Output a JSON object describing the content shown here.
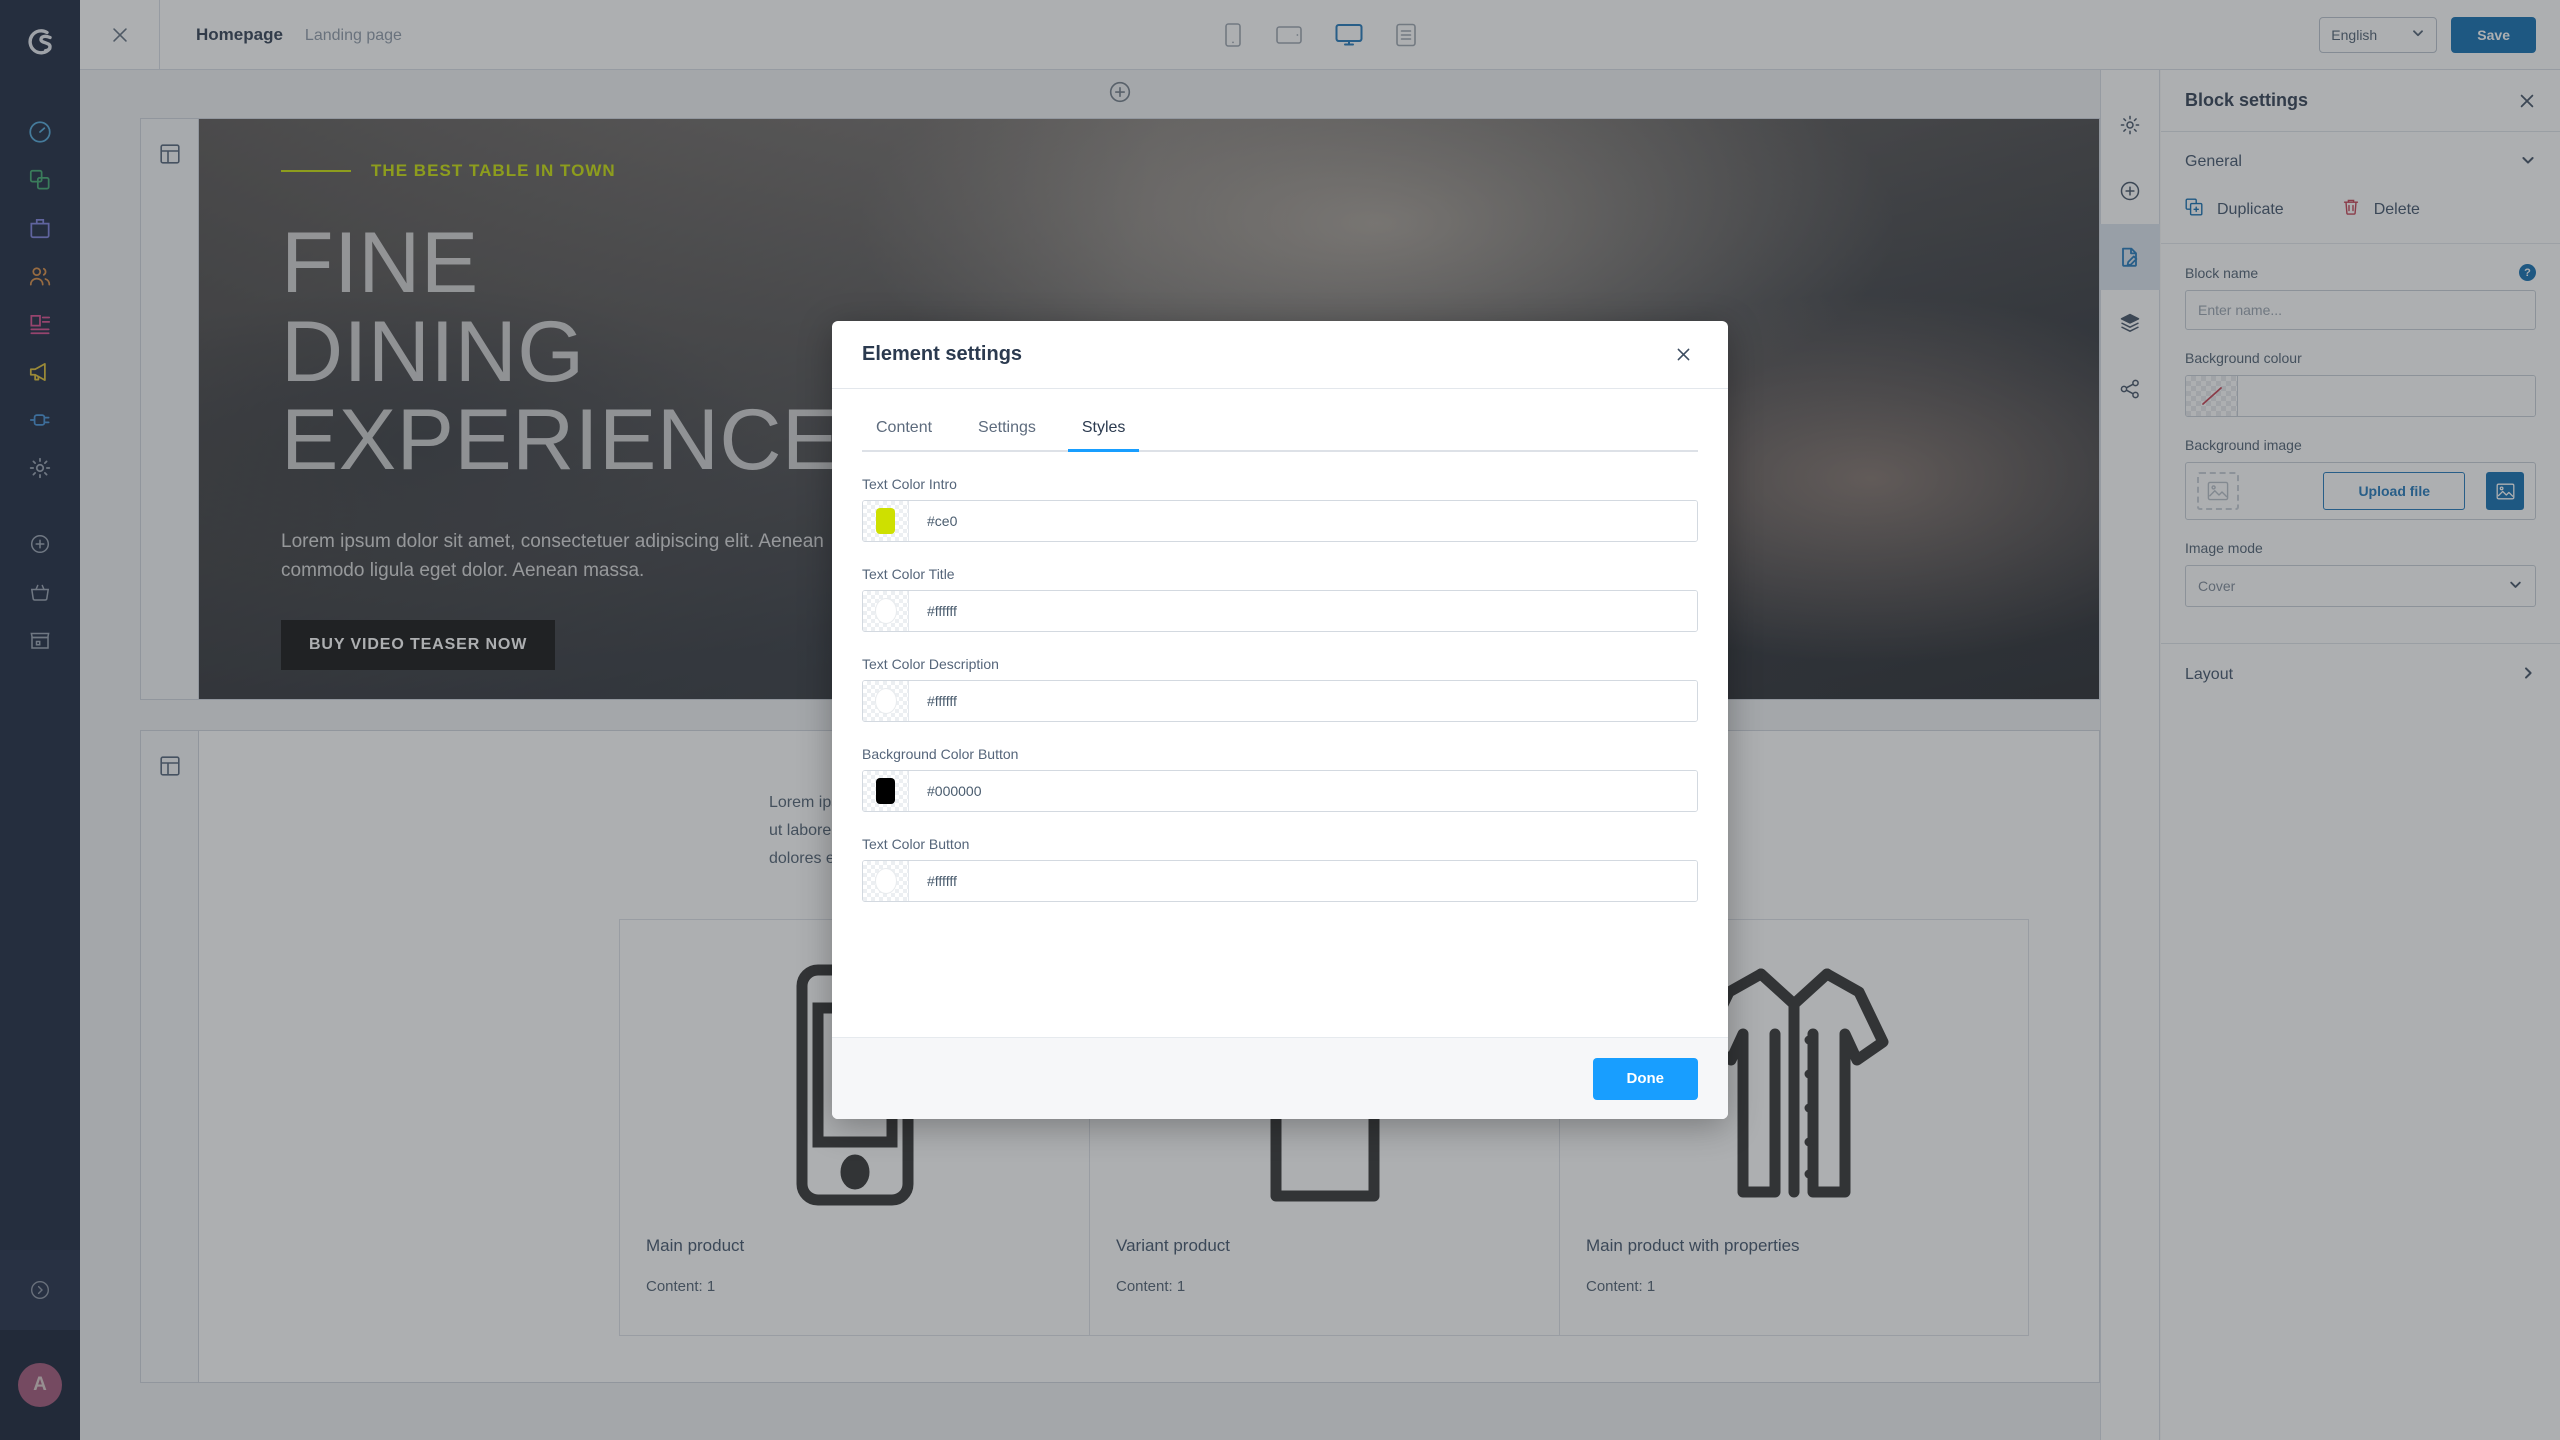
{
  "app": {
    "logo_icon": "shopware-logo-icon"
  },
  "left_nav": {
    "close_icon": "close-icon",
    "items": [
      {
        "icon": "dashboard-icon",
        "label": "Dashboard",
        "color": "#4da6d9"
      },
      {
        "icon": "catalogue-icon",
        "label": "Catalogues",
        "color": "#3aa86b"
      },
      {
        "icon": "orders-icon",
        "label": "Orders",
        "color": "#7b7ede"
      },
      {
        "icon": "customers-icon",
        "label": "Customers",
        "color": "#d98a3f"
      },
      {
        "icon": "content-icon",
        "label": "Content",
        "color": "#d9488c"
      },
      {
        "icon": "marketing-icon",
        "label": "Marketing",
        "color": "#e0c02e"
      },
      {
        "icon": "extensions-icon",
        "label": "Extensions",
        "color": "#3f90d9"
      },
      {
        "icon": "settings-gear-icon",
        "label": "Settings",
        "color": "#97a1b0"
      },
      {
        "icon": "plus-circle-icon",
        "label": "Add",
        "color": "#97a1b0"
      },
      {
        "icon": "basket-icon",
        "label": "Basket",
        "color": "#97a1b0"
      },
      {
        "icon": "store-icon",
        "label": "Store",
        "color": "#97a1b0"
      }
    ],
    "collapse_icon": "chevron-right-circle-icon",
    "avatar_initial": "A",
    "avatar_color": "#9f5175"
  },
  "header": {
    "breadcrumb_main": "Homepage",
    "breadcrumb_sub": "Landing page",
    "devices": [
      {
        "icon": "mobile-icon",
        "label": "Mobile",
        "active": false
      },
      {
        "icon": "tablet-icon",
        "label": "Tablet",
        "active": false
      },
      {
        "icon": "desktop-icon",
        "label": "Desktop",
        "active": true
      },
      {
        "icon": "list-view-icon",
        "label": "List view",
        "active": false
      }
    ],
    "language_value": "English",
    "language_chevron_icon": "chevron-down-icon",
    "save_label": "Save",
    "save_color": "#0a6aaf"
  },
  "stage": {
    "add_section_icon": "plus-circle-icon",
    "block_handle_icon": "layout-block-icon",
    "hero": {
      "eyebrow": "THE BEST TABLE IN TOWN",
      "eyebrow_color": "#c8e000",
      "title_lines": [
        "FINE",
        "DINING",
        "EXPERIENCE"
      ],
      "description": "Lorem ipsum dolor sit amet, consectetuer adipiscing elit. Aenean commodo ligula eget dolor. Aenean massa.",
      "cta_label": "BUY VIDEO TEASER NOW",
      "cta_bg": "#000000",
      "cta_text_color": "#ffffff"
    },
    "listing": {
      "text": "Lorem ipsum dolor sit amet, consetetur sadipscing elitr, sed diam nonumy eirmod tempor invidunt ut labore et dolore magna aliquyam erat, sed diam voluptua. At vero eos et accusam et justo duo dolores et ea rebum.",
      "cards": [
        {
          "art_icon": "mobile-phone-outline-icon",
          "title": "Main product",
          "meta": "Content: 1"
        },
        {
          "art_icon": "shirt-outline-icon",
          "title": "Variant product",
          "meta": "Content: 1"
        },
        {
          "art_icon": "jacket-outline-icon",
          "title": "Main product with properties",
          "meta": "Content: 1"
        }
      ]
    }
  },
  "tool_rail": {
    "items": [
      {
        "icon": "settings-gear-icon",
        "label": "Settings",
        "active": false
      },
      {
        "icon": "plus-circle-icon",
        "label": "Add block",
        "active": false
      },
      {
        "icon": "edit-document-icon",
        "label": "Edit content",
        "active": true
      },
      {
        "icon": "layers-icon",
        "label": "Layers",
        "active": false
      },
      {
        "icon": "share-icon",
        "label": "Share",
        "active": false
      }
    ]
  },
  "block_settings": {
    "title": "Block settings",
    "close_icon": "close-icon",
    "general": {
      "label": "General",
      "chevron_icon": "chevron-down-icon"
    },
    "duplicate": {
      "label": "Duplicate",
      "icon": "duplicate-icon",
      "color": "#0a6aaf"
    },
    "delete": {
      "label": "Delete",
      "icon": "trash-icon",
      "color": "#c3374b"
    },
    "block_name": {
      "label": "Block name",
      "placeholder": "Enter name...",
      "value": "",
      "help_icon": "question-mark-icon"
    },
    "background_colour": {
      "label": "Background colour",
      "value": "",
      "swatch_icon": "no-color-icon"
    },
    "background_image": {
      "label": "Background image",
      "thumb_icon": "image-placeholder-icon",
      "upload_label": "Upload file",
      "media_icon": "media-library-icon"
    },
    "image_mode": {
      "label": "Image mode",
      "value": "Cover",
      "chevron_icon": "chevron-down-icon"
    },
    "layout": {
      "label": "Layout",
      "chevron_icon": "chevron-right-icon"
    }
  },
  "modal": {
    "title": "Element settings",
    "close_icon": "close-icon",
    "tabs": [
      {
        "label": "Content",
        "active": false
      },
      {
        "label": "Settings",
        "active": false
      },
      {
        "label": "Styles",
        "active": true
      }
    ],
    "accent_color": "#189eff",
    "fields": [
      {
        "label": "Text Color Intro",
        "value": "#ce0",
        "swatch": "#cee000",
        "light": false
      },
      {
        "label": "Text Color Title",
        "value": "#ffffff",
        "swatch": "#ffffff",
        "light": true
      },
      {
        "label": "Text Color Description",
        "value": "#ffffff",
        "swatch": "#ffffff",
        "light": true
      },
      {
        "label": "Background Color Button",
        "value": "#000000",
        "swatch": "#000000",
        "light": false
      },
      {
        "label": "Text Color Button",
        "value": "#ffffff",
        "swatch": "#ffffff",
        "light": true
      }
    ],
    "done_label": "Done"
  }
}
